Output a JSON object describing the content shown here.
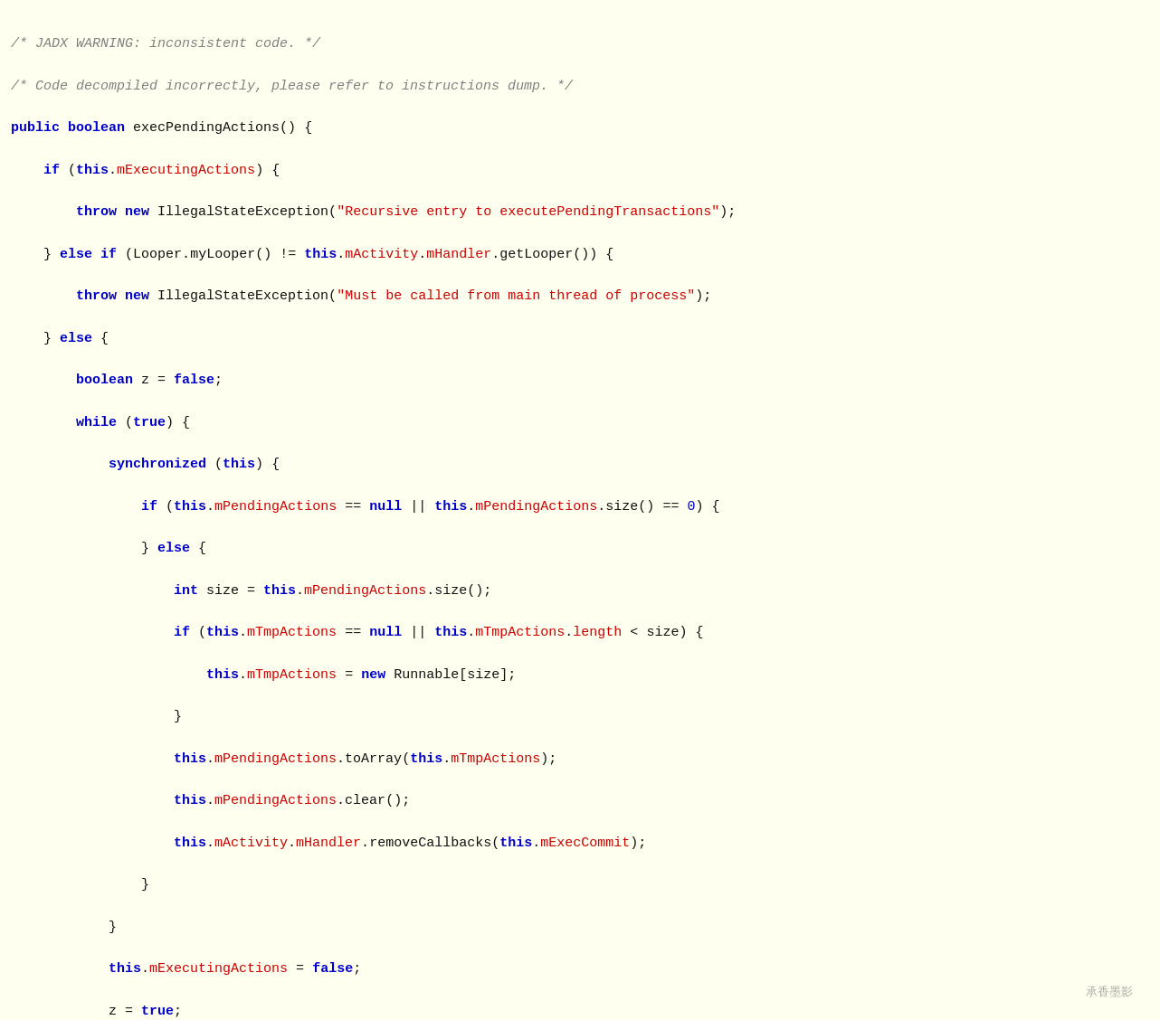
{
  "code": {
    "warning1": "/* JADX WARNING: inconsistent code. */",
    "warning2": "/* Code decompiled incorrectly, please refer to instructions dump. */",
    "watermark": "承香墨影"
  }
}
